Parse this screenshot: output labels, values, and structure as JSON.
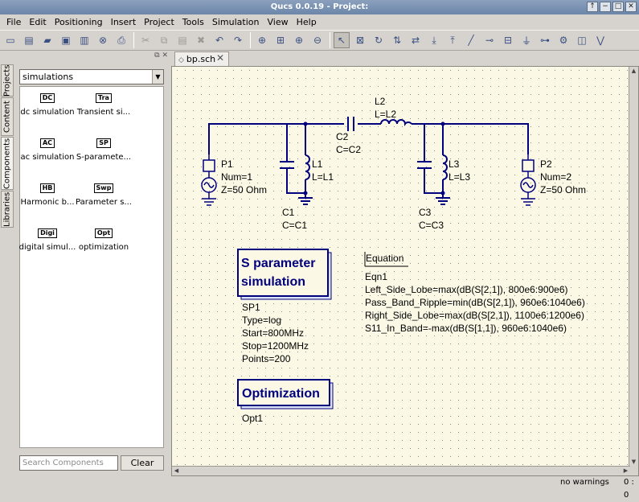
{
  "window": {
    "title": "Qucs 0.0.19 - Project:"
  },
  "window_buttons": [
    "↑",
    "−",
    "□",
    "✕"
  ],
  "menu": [
    "File",
    "Edit",
    "Positioning",
    "Insert",
    "Project",
    "Tools",
    "Simulation",
    "View",
    "Help"
  ],
  "toolbar": {
    "groups": [
      [
        "new-file-icon",
        "new-text-icon",
        "open-icon",
        "save-icon",
        "save-all-icon",
        "close-icon",
        "print-icon"
      ],
      [
        "cut-icon",
        "copy-icon",
        "paste-icon",
        "delete-icon",
        "undo-icon",
        "redo-icon"
      ],
      [
        "zoom-fit-icon",
        "zoom-selection-icon",
        "zoom-in-icon",
        "zoom-out-icon"
      ],
      [
        "select-icon",
        "edit-properties-icon",
        "rotate-icon",
        "mirror-x-icon",
        "mirror-y-icon",
        "enter-subcircuit-icon",
        "exit-subcircuit-icon",
        "wire-icon",
        "wire-label-icon",
        "equation-icon",
        "ground-icon",
        "port-icon",
        "simulate-icon",
        "view-data-icon",
        "marker-icon"
      ]
    ],
    "glyphs": [
      "▭",
      "▤",
      "▰",
      "▣",
      "▥",
      "⊗",
      "⎙",
      "✂",
      "⧉",
      "▤",
      "✖",
      "↶",
      "↷",
      "⊕",
      "⊞",
      "⊕",
      "⊖",
      "↖",
      "⊠",
      "↻",
      "⇅",
      "⇄",
      "⤓",
      "⤒",
      "╱",
      "⊸",
      "⊟",
      "⏚",
      "⊶",
      "⚙",
      "◫",
      "⋁"
    ]
  },
  "side_tabs": [
    "Projects",
    "Content",
    "Components",
    "Libraries"
  ],
  "panel": {
    "header_icons": "⧉ ✕",
    "category": "simulations",
    "components": [
      {
        "icon": "DC",
        "label": "dc simulation"
      },
      {
        "icon": "Tra",
        "label": "Transient si..."
      },
      {
        "icon": "AC",
        "label": "ac simulation"
      },
      {
        "icon": "SP",
        "label": "S-paramete..."
      },
      {
        "icon": "HB",
        "label": "Harmonic b..."
      },
      {
        "icon": "Swp",
        "label": "Parameter s..."
      },
      {
        "icon": "Digi",
        "label": "digital simul..."
      },
      {
        "icon": "Opt",
        "label": "optimization"
      }
    ],
    "search_placeholder": "Search Components",
    "clear_label": "Clear"
  },
  "document_tab": {
    "label": "bp.sch",
    "close": "✕"
  },
  "schematic": {
    "P1": [
      "P1",
      "Num=1",
      "Z=50 Ohm"
    ],
    "P2": [
      "P2",
      "Num=2",
      "Z=50 Ohm"
    ],
    "L1": [
      "L1",
      "L=L1"
    ],
    "C1": [
      "C1",
      "C=C1"
    ],
    "C2": [
      "C2",
      "C=C2"
    ],
    "L2": [
      "L2",
      "L=L2"
    ],
    "L3": [
      "L3",
      "L=L3"
    ],
    "C3": [
      "C3",
      "C=C3"
    ],
    "sp_block_title": [
      "S parameter",
      "simulation"
    ],
    "sp_props": [
      "SP1",
      "Type=log",
      "Start=800MHz",
      "Stop=1200MHz",
      "Points=200"
    ],
    "opt_block_title": "Optimization",
    "opt_props": [
      "Opt1"
    ],
    "equation_title": "Equation",
    "equation_lines": [
      "Eqn1",
      "Left_Side_Lobe=max(dB(S[2,1]), 800e6:900e6)",
      "Pass_Band_Ripple=min(dB(S[2,1]), 960e6:1040e6)",
      "Right_Side_Lobe=max(dB(S[2,1]), 1100e6:1200e6)",
      "S11_In_Band=-max(dB(S[1,1]), 960e6:1040e6)"
    ]
  },
  "statusbar": {
    "warnings": "no warnings",
    "position": "0 : 0"
  },
  "colors": {
    "canvas_bg": "#fbf8e5",
    "wire": "#00007f",
    "grid_dot": "#8a8a8a",
    "text": "#000000"
  }
}
